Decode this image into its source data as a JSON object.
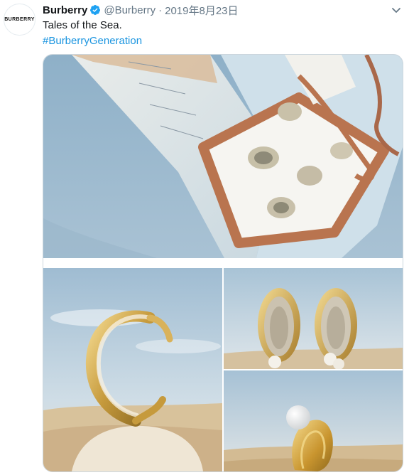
{
  "tweet": {
    "avatar_text": "BURBERRY",
    "display_name": "Burberry",
    "verified": true,
    "handle": "@Burberry",
    "separator": "·",
    "date": "2019年8月23日",
    "text": "Tales of the Sea.",
    "hashtag": "#BurberryGeneration"
  },
  "media": {
    "photos": [
      {
        "icon": "silk-scarf-photo"
      },
      {
        "icon": "gold-cuff-photo"
      },
      {
        "icon": "oyster-earrings-photo"
      },
      {
        "icon": "pearl-ring-photo"
      }
    ]
  },
  "colors": {
    "link": "#1b95e0",
    "secondary_text": "#657786",
    "verified_badge": "#1da1f2",
    "border": "#ccd6dd"
  }
}
